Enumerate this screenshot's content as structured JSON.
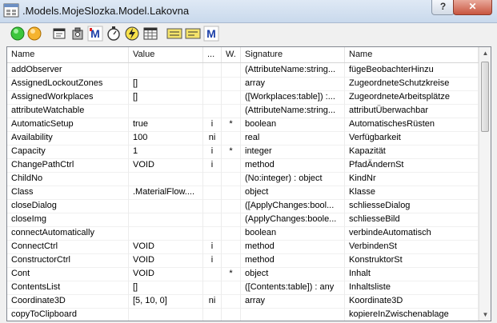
{
  "window": {
    "title": ".Models.MojeSlozka.Model.Lakovna",
    "help_label": "?",
    "close_label": "✕"
  },
  "toolbar": {
    "buttons": [
      {
        "name": "green-circle-icon",
        "color": "#2eb82e"
      },
      {
        "name": "orange-circle-icon",
        "color": "#f0a020"
      },
      {
        "name": "window-icon"
      },
      {
        "name": "gear-icon"
      },
      {
        "name": "m-method-icon",
        "text": "M"
      },
      {
        "name": "timer-icon"
      },
      {
        "name": "lightning-icon"
      },
      {
        "name": "table-grid-icon"
      },
      {
        "name": "attribute-icon-1"
      },
      {
        "name": "attribute-icon-2"
      },
      {
        "name": "m-icon",
        "text": "M"
      }
    ]
  },
  "table": {
    "headers": [
      "Name",
      "Value",
      "...",
      "W.",
      "Signature",
      "Name"
    ],
    "rows": [
      [
        "addObserver",
        "",
        "",
        "",
        "(AttributeName:string...",
        "fügeBeobachterHinzu"
      ],
      [
        "AssignedLockoutZones",
        "[]",
        "",
        "",
        "array",
        "ZugeordneteSchutzkreise"
      ],
      [
        "AssignedWorkplaces",
        "[]",
        "",
        "",
        "([Workplaces:table]) :...",
        "ZugeordneteArbeitsplätze"
      ],
      [
        "attributeWatchable",
        "",
        "",
        "",
        "(AttributeName:string...",
        "attributÜberwachbar"
      ],
      [
        "AutomaticSetup",
        "true",
        "i",
        "*",
        "boolean",
        "AutomatischesRüsten"
      ],
      [
        "Availability",
        "100",
        "ni",
        "",
        "real",
        "Verfügbarkeit"
      ],
      [
        "Capacity",
        "1",
        "i",
        "*",
        "integer",
        "Kapazität"
      ],
      [
        "ChangePathCtrl",
        "VOID",
        "i",
        "",
        "method",
        "PfadÄndernSt"
      ],
      [
        "ChildNo",
        "",
        "",
        "",
        "(No:integer) : object",
        "KindNr"
      ],
      [
        "Class",
        ".MaterialFlow....",
        "",
        "",
        "object",
        "Klasse"
      ],
      [
        "closeDialog",
        "",
        "",
        "",
        "([ApplyChanges:bool...",
        "schliesseDialog"
      ],
      [
        "closeImg",
        "",
        "",
        "",
        "(ApplyChanges:boole...",
        "schliesseBild"
      ],
      [
        "connectAutomatically",
        "",
        "",
        "",
        "boolean",
        "verbindeAutomatisch"
      ],
      [
        "ConnectCtrl",
        "VOID",
        "i",
        "",
        "method",
        "VerbindenSt"
      ],
      [
        "ConstructorCtrl",
        "VOID",
        "i",
        "",
        "method",
        "KonstruktorSt"
      ],
      [
        "Cont",
        "VOID",
        "",
        "*",
        "object",
        "Inhalt"
      ],
      [
        "ContentsList",
        "[]",
        "",
        "",
        "([Contents:table]) : any",
        "Inhaltsliste"
      ],
      [
        "Coordinate3D",
        "[5, 10, 0]",
        "ni",
        "",
        "array",
        "Koordinate3D"
      ],
      [
        "copyToClipboard",
        "",
        "",
        "",
        "",
        "kopiereInZwischenablage"
      ]
    ]
  },
  "scrollbar": {
    "up": "▲",
    "down": "▼"
  }
}
